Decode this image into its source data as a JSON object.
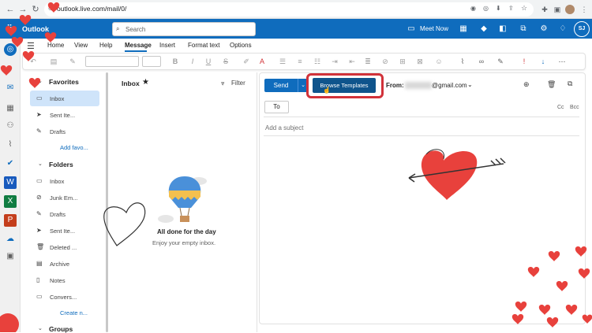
{
  "browser": {
    "url": "outlook.live.com/mail/0/",
    "icons": [
      "back-icon",
      "forward-icon",
      "reload-icon",
      "site-info-icon",
      "eye-icon",
      "extension-icon",
      "download-icon",
      "share-icon",
      "star-icon",
      "puzzle-icon",
      "sidepanel-icon",
      "profile-icon",
      "menu-icon"
    ]
  },
  "outlook": {
    "app_name": "Outlook",
    "search_placeholder": "Search",
    "meet_now": "Meet Now",
    "avatar_initials": "SJ",
    "ribbon_tabs": [
      "Home",
      "View",
      "Help",
      "Message",
      "Insert",
      "Format text",
      "Options"
    ],
    "active_tab": "Message"
  },
  "folders": {
    "favorites_title": "Favorites",
    "favorites": [
      {
        "label": "Inbox",
        "icon": "inbox-icon",
        "selected": true
      },
      {
        "label": "Sent Ite...",
        "icon": "send-icon",
        "selected": false
      },
      {
        "label": "Drafts",
        "icon": "drafts-icon",
        "selected": false
      }
    ],
    "add_favorite": "Add favo...",
    "folders_title": "Folders",
    "folder_items": [
      {
        "label": "Inbox",
        "icon": "inbox-icon"
      },
      {
        "label": "Junk Em...",
        "icon": "junk-icon"
      },
      {
        "label": "Drafts",
        "icon": "drafts-icon"
      },
      {
        "label": "Sent Ite...",
        "icon": "send-icon"
      },
      {
        "label": "Deleted ...",
        "icon": "trash-icon"
      },
      {
        "label": "Archive",
        "icon": "archive-icon"
      },
      {
        "label": "Notes",
        "icon": "notes-icon"
      },
      {
        "label": "Convers...",
        "icon": "folder-icon"
      }
    ],
    "create_new": "Create n...",
    "groups_title": "Groups"
  },
  "message_list": {
    "title": "Inbox",
    "filter_label": "Filter",
    "empty_title": "All done for the day",
    "empty_subtitle": "Enjoy your empty inbox."
  },
  "compose": {
    "send_label": "Send",
    "templates_label": "Browse Templates",
    "from_label": "From:",
    "from_value": "@gmail.com",
    "to_label": "To",
    "cc_label": "Cc",
    "bcc_label": "Bcc",
    "subject_placeholder": "Add a subject"
  },
  "colors": {
    "brand_blue": "#0f6cbd",
    "highlight_red": "#d1323a",
    "heart_red": "#e8413c"
  }
}
